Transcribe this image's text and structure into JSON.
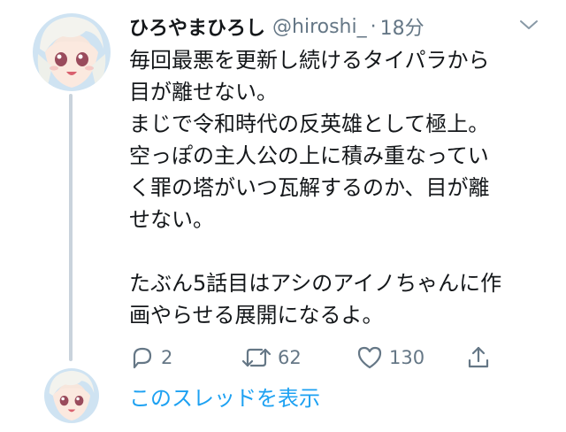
{
  "tweet": {
    "display_name": "ひろやまひろし",
    "handle": "@hiroshi_",
    "separator": "·",
    "time": "18分",
    "lines": [
      "毎回最悪を更新し続けるタイパラから",
      "目が離せない。",
      "まじで令和時代の反英雄として極上。",
      "空っぽの主人公の上に積み重なってい",
      "く罪の塔がいつ瓦解するのか、目が離",
      "せない。",
      "",
      "たぶん5話目はアシのアイノちゃんに作",
      "画やらせる展開になるよ。"
    ],
    "actions": {
      "reply_count": "2",
      "retweet_count": "62",
      "like_count": "130"
    }
  },
  "thread": {
    "show_thread_label": "このスレッドを表示"
  },
  "icons": {
    "reply": "reply-icon",
    "retweet": "retweet-icon",
    "like": "heart-icon",
    "share": "share-icon",
    "menu": "chevron-down-icon"
  },
  "colors": {
    "text": "#14171a",
    "secondary": "#657786",
    "link": "#1da1f2",
    "thread_line": "#c9d3dc"
  }
}
